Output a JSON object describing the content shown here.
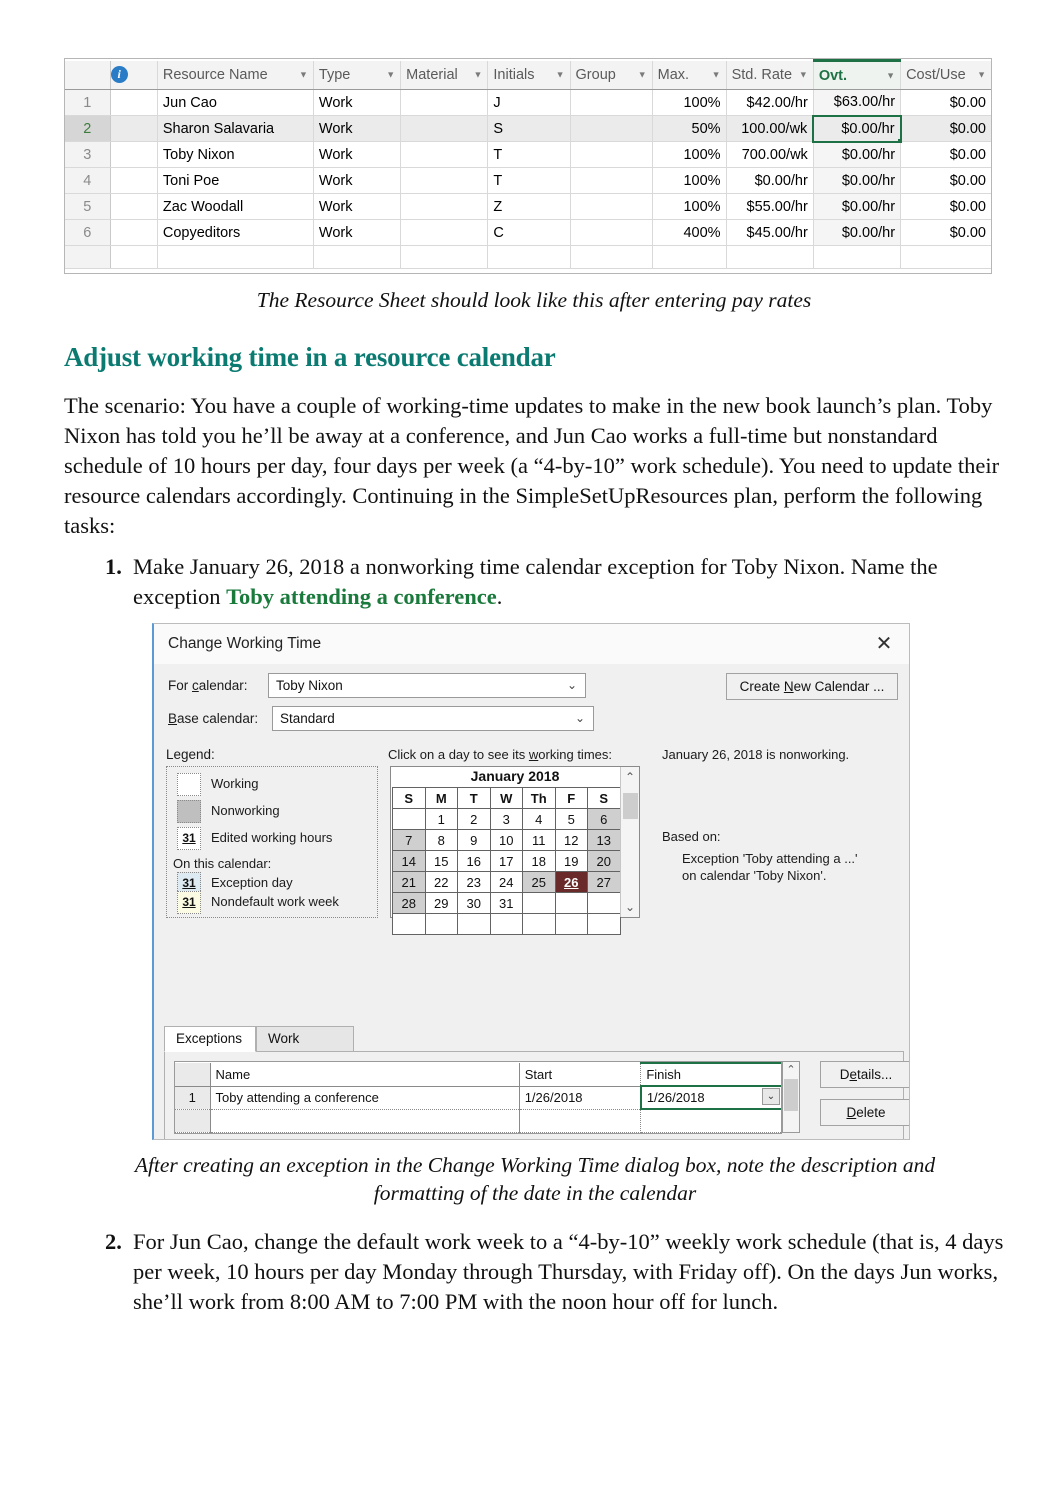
{
  "resource_sheet": {
    "info_icon": "info-icon",
    "columns": [
      {
        "key": "rownum",
        "label": ""
      },
      {
        "key": "info",
        "label": ""
      },
      {
        "key": "name",
        "label": "Resource Name"
      },
      {
        "key": "type",
        "label": "Type"
      },
      {
        "key": "material",
        "label": "Material"
      },
      {
        "key": "initials",
        "label": "Initials"
      },
      {
        "key": "group",
        "label": "Group"
      },
      {
        "key": "max",
        "label": "Max."
      },
      {
        "key": "std_rate",
        "label": "Std. Rate"
      },
      {
        "key": "ovt",
        "label": "Ovt."
      },
      {
        "key": "cost_use",
        "label": "Cost/Use"
      }
    ],
    "selected_column": "Ovt.",
    "selected_row": 2,
    "rows": [
      {
        "num": "1",
        "name": "Jun Cao",
        "type": "Work",
        "material": "",
        "initials": "J",
        "group": "",
        "max": "100%",
        "std_rate": "$42.00/hr",
        "ovt": "$63.00/hr",
        "cost_use": "$0.00"
      },
      {
        "num": "2",
        "name": "Sharon Salavaria",
        "type": "Work",
        "material": "",
        "initials": "S",
        "group": "",
        "max": "50%",
        "std_rate": "100.00/wk",
        "ovt": "$0.00/hr",
        "cost_use": "$0.00"
      },
      {
        "num": "3",
        "name": "Toby Nixon",
        "type": "Work",
        "material": "",
        "initials": "T",
        "group": "",
        "max": "100%",
        "std_rate": "700.00/wk",
        "ovt": "$0.00/hr",
        "cost_use": "$0.00"
      },
      {
        "num": "4",
        "name": "Toni Poe",
        "type": "Work",
        "material": "",
        "initials": "T",
        "group": "",
        "max": "100%",
        "std_rate": "$0.00/hr",
        "ovt": "$0.00/hr",
        "cost_use": "$0.00"
      },
      {
        "num": "5",
        "name": "Zac Woodall",
        "type": "Work",
        "material": "",
        "initials": "Z",
        "group": "",
        "max": "100%",
        "std_rate": "$55.00/hr",
        "ovt": "$0.00/hr",
        "cost_use": "$0.00"
      },
      {
        "num": "6",
        "name": "Copyeditors",
        "type": "Work",
        "material": "",
        "initials": "C",
        "group": "",
        "max": "400%",
        "std_rate": "$45.00/hr",
        "ovt": "$0.00/hr",
        "cost_use": "$0.00"
      }
    ]
  },
  "captions": {
    "figure_1": "The Resource Sheet should look like this after entering pay rates",
    "figure_2_line1": "After creating an exception in the Change Working Time dialog box, note the",
    "figure_2_line2": "description and formatting of the date in the calendar"
  },
  "heading": "Adjust working time in a resource calendar",
  "paragraph": "The scenario: You have a couple of working-time updates to make in the new book launch’s plan. Toby Nixon has told you he’ll be away at a conference, and Jun Cao works a full-time but nonstandard schedule of 10 hours per day, four days per week (a “4-by-10” work schedule). You need to update their resource calendars accordingly. Continuing in the SimpleSetUpResources plan, perform the following tasks:",
  "steps": [
    {
      "number": "1.",
      "text_before": "Make January 26, 2018 a nonworking time calendar exception for Toby Nixon. Name the exception ",
      "emphasis": "Toby attending a conference",
      "text_after": "."
    },
    {
      "number": "2.",
      "text": "For Jun Cao, change the default work week to a “4-by-10” weekly work schedule (that is, 4 days per week, 10 hours per day Monday through Thursday, with Friday off). On the days Jun works, she’ll work from 8:00 AM to 7:00 PM with the noon hour off for lunch."
    }
  ],
  "dialog": {
    "title": "Change Working Time",
    "close_icon": "✕",
    "for_calendar_label": "For calendar:",
    "for_calendar_value": "Toby Nixon",
    "base_calendar_label": "Base calendar:",
    "base_calendar_value": "Standard",
    "create_new_calendar_button": "Create New Calendar ...",
    "legend": {
      "title": "Legend:",
      "items": [
        {
          "swatch": "",
          "label": "Working",
          "fill": "#ffffff"
        },
        {
          "swatch": "",
          "label": "Nonworking",
          "fill": "#bfbfbf"
        },
        {
          "swatch": "31",
          "label": "Edited working hours",
          "fill": "#ffffff"
        }
      ],
      "subtitle": "On this calendar:",
      "items2": [
        {
          "swatch": "31",
          "label": "Exception day",
          "fill": "#ddeaf2"
        },
        {
          "swatch": "31",
          "label": "Nondefault work week",
          "fill": "#fbfbe4"
        }
      ]
    },
    "calendar": {
      "instruction": "Click on a day to see its working times:",
      "month_title": "January 2018",
      "weekday_headers": [
        "S",
        "M",
        "T",
        "W",
        "Th",
        "F",
        "S"
      ],
      "weeks": [
        [
          {
            "d": "",
            "state": "blank"
          },
          {
            "d": "1",
            "state": "working"
          },
          {
            "d": "2",
            "state": "working"
          },
          {
            "d": "3",
            "state": "working"
          },
          {
            "d": "4",
            "state": "working"
          },
          {
            "d": "5",
            "state": "working"
          },
          {
            "d": "6",
            "state": "nonworking"
          }
        ],
        [
          {
            "d": "7",
            "state": "nonworking"
          },
          {
            "d": "8",
            "state": "working"
          },
          {
            "d": "9",
            "state": "working"
          },
          {
            "d": "10",
            "state": "working"
          },
          {
            "d": "11",
            "state": "working"
          },
          {
            "d": "12",
            "state": "working"
          },
          {
            "d": "13",
            "state": "nonworking"
          }
        ],
        [
          {
            "d": "14",
            "state": "nonworking"
          },
          {
            "d": "15",
            "state": "working"
          },
          {
            "d": "16",
            "state": "working"
          },
          {
            "d": "17",
            "state": "working"
          },
          {
            "d": "18",
            "state": "working"
          },
          {
            "d": "19",
            "state": "working"
          },
          {
            "d": "20",
            "state": "nonworking"
          }
        ],
        [
          {
            "d": "21",
            "state": "nonworking"
          },
          {
            "d": "22",
            "state": "working"
          },
          {
            "d": "23",
            "state": "working"
          },
          {
            "d": "24",
            "state": "working"
          },
          {
            "d": "25",
            "state": "nonworking"
          },
          {
            "d": "26",
            "state": "selected"
          },
          {
            "d": "27",
            "state": "nonworking"
          }
        ],
        [
          {
            "d": "28",
            "state": "nonworking"
          },
          {
            "d": "29",
            "state": "working"
          },
          {
            "d": "30",
            "state": "working"
          },
          {
            "d": "31",
            "state": "working"
          },
          {
            "d": "",
            "state": "blank"
          },
          {
            "d": "",
            "state": "blank"
          },
          {
            "d": "",
            "state": "blank"
          }
        ],
        [
          {
            "d": "",
            "state": "blank"
          },
          {
            "d": "",
            "state": "blank"
          },
          {
            "d": "",
            "state": "blank"
          },
          {
            "d": "",
            "state": "blank"
          },
          {
            "d": "",
            "state": "blank"
          },
          {
            "d": "",
            "state": "blank"
          },
          {
            "d": "",
            "state": "blank"
          }
        ]
      ],
      "selected_day": "26"
    },
    "info_panel": {
      "status": "January 26, 2018 is nonworking.",
      "based_on_title": "Based on:",
      "based_on_line1": "Exception 'Toby attending a ...'",
      "based_on_line2": "on calendar 'Toby Nixon'."
    },
    "tabs": [
      {
        "label": "Exceptions",
        "active": true
      },
      {
        "label": "Work Weeks",
        "active": false
      }
    ],
    "exceptions_table": {
      "headers": [
        "",
        "Name",
        "Start",
        "Finish"
      ],
      "rows": [
        {
          "num": "1",
          "name": "Toby attending a conference",
          "start": "1/26/2018",
          "finish": "1/26/2018"
        },
        {
          "num": "",
          "name": "",
          "start": "",
          "finish": ""
        }
      ],
      "active_cell": "finish"
    },
    "details_button": "Details...",
    "delete_button": "Delete"
  },
  "colors": {
    "heading_teal": "#0b7b72",
    "emphasis_green": "#1a7a3c",
    "selection_green": "#1e7145",
    "selected_day_red": "#6b2a2a",
    "dialog_accent_blue": "#5b9bd5",
    "info_icon_blue": "#2a7cc7"
  }
}
